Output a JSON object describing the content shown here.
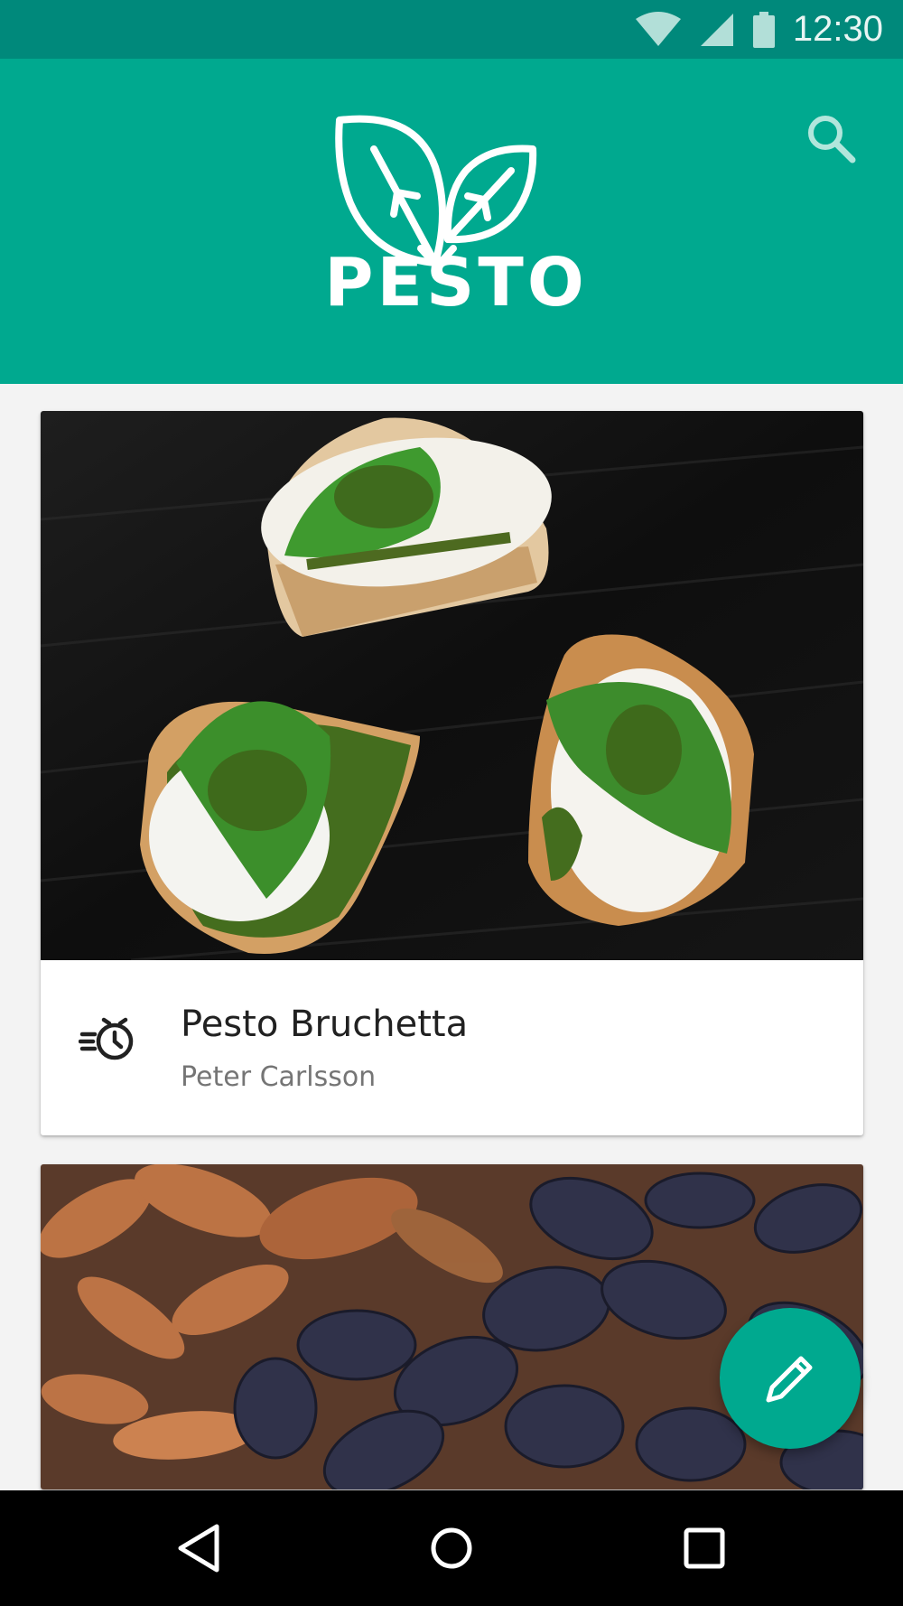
{
  "status_bar": {
    "time": "12:30",
    "icons": [
      "wifi-icon",
      "cellular-signal-icon",
      "battery-icon"
    ]
  },
  "app_bar": {
    "title": "PESTO",
    "logo": "basil-leaves-logo",
    "search_icon": "search-icon",
    "background": "#00a98f"
  },
  "cards": [
    {
      "title": "Pesto Bruchetta",
      "author": "Peter Carlsson",
      "image": "bruschetta-with-mozzarella-basil-and-pesto",
      "icon": "timer-icon"
    },
    {
      "image": "purple-and-orange-fingerling-potatoes"
    }
  ],
  "fab": {
    "icon": "edit-pencil-icon",
    "color": "#00a98f"
  },
  "nav_bar": {
    "buttons": [
      "back-icon",
      "home-icon",
      "recents-icon"
    ]
  },
  "colors": {
    "status_bar": "#00897b",
    "primary": "#00a98f",
    "background": "#f3f3f3"
  }
}
